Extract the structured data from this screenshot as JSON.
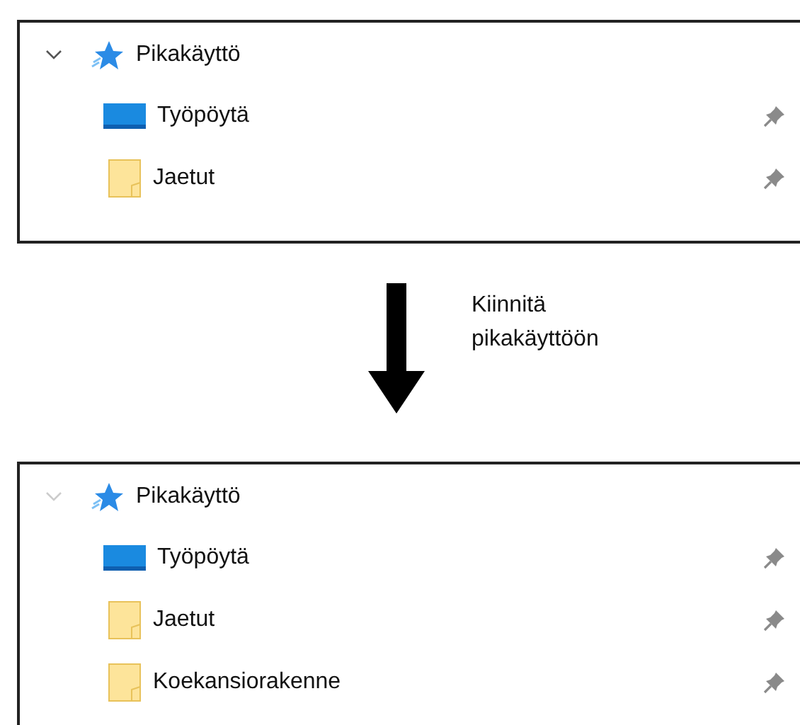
{
  "panels": [
    {
      "header": {
        "label": "Pikakäyttö",
        "expanded": true,
        "hovered": true
      },
      "items": [
        {
          "kind": "desktop",
          "label": "Työpöytä",
          "pinned": true
        },
        {
          "kind": "folder",
          "label": "Jaetut",
          "pinned": true
        }
      ]
    },
    {
      "header": {
        "label": "Pikakäyttö",
        "expanded": true,
        "hovered": false
      },
      "items": [
        {
          "kind": "desktop",
          "label": "Työpöytä",
          "pinned": true
        },
        {
          "kind": "folder",
          "label": "Jaetut",
          "pinned": true
        },
        {
          "kind": "folder",
          "label": "Koekansiorakenne",
          "pinned": true
        }
      ]
    }
  ],
  "step": {
    "label": "Kiinnitä pikakäyttöön"
  }
}
